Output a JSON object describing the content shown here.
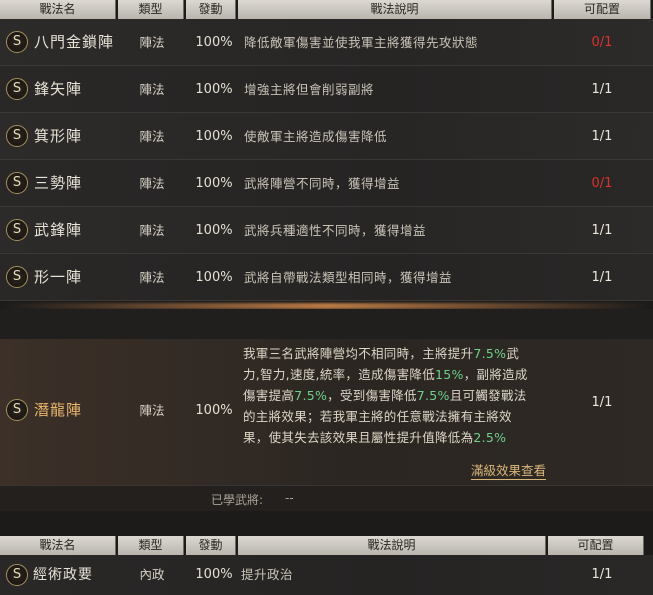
{
  "headers": {
    "name": "戰法名",
    "type": "類型",
    "rate": "發動",
    "desc": "戰法說明",
    "config": "可配置"
  },
  "tactics": [
    {
      "icon": "S",
      "name": "八門金鎖陣",
      "type": "陣法",
      "rate": "100%",
      "desc": "降低敵軍傷害並使我軍主將獲得先攻狀態",
      "config": "0/1",
      "config_color": "#d8322c"
    },
    {
      "icon": "S",
      "name": "鋒矢陣",
      "type": "陣法",
      "rate": "100%",
      "desc": "增強主將但會削弱副將",
      "config": "1/1",
      "config_color": "#ece7dc"
    },
    {
      "icon": "S",
      "name": "箕形陣",
      "type": "陣法",
      "rate": "100%",
      "desc": "使敵軍主將造成傷害降低",
      "config": "1/1",
      "config_color": "#ece7dc"
    },
    {
      "icon": "S",
      "name": "三勢陣",
      "type": "陣法",
      "rate": "100%",
      "desc": "武將陣營不同時，獲得增益",
      "config": "0/1",
      "config_color": "#d8322c"
    },
    {
      "icon": "S",
      "name": "武鋒陣",
      "type": "陣法",
      "rate": "100%",
      "desc": "武將兵種適性不同時，獲得增益",
      "config": "1/1",
      "config_color": "#ece7dc"
    },
    {
      "icon": "S",
      "name": "形一陣",
      "type": "陣法",
      "rate": "100%",
      "desc": "武將自帶戰法類型相同時，獲得增益",
      "config": "1/1",
      "config_color": "#ece7dc"
    }
  ],
  "expanded": {
    "icon": "S",
    "name": "潛龍陣",
    "type": "陣法",
    "rate": "100%",
    "config": "1/1",
    "desc_lines": [
      [
        "我軍三名武將陣營均不相同時，主將提升",
        "7.5%",
        "武"
      ],
      [
        "力,智力,速度,統率，造成傷害降低",
        "15%",
        "，副將造成"
      ],
      [
        "傷害提高",
        "7.5%",
        "，受到傷害降低",
        "7.5%",
        "且可觸發戰法"
      ],
      [
        "的主將效果；若我軍主將的任意戰法擁有主將效"
      ],
      [
        "果，使其失去該效果且屬性提升值降低為",
        "2.5%",
        ""
      ]
    ],
    "full_effect_link": "滿級效果查看",
    "learned_label": "已學武將:",
    "learned_value": "--"
  },
  "second_table": {
    "headers": {
      "name": "戰法名",
      "type": "類型",
      "rate": "發動",
      "desc": "戰法說明",
      "config": "可配置"
    },
    "row": {
      "icon": "S",
      "name": "經術政要",
      "type": "內政",
      "rate": "100%",
      "desc": "提升政治",
      "config": "1/1"
    }
  },
  "colors": {
    "highlight": "#6fd08a",
    "unavailable": "#d8322c",
    "link": "#d9b67a",
    "expanded_name": "#e9b66c"
  }
}
